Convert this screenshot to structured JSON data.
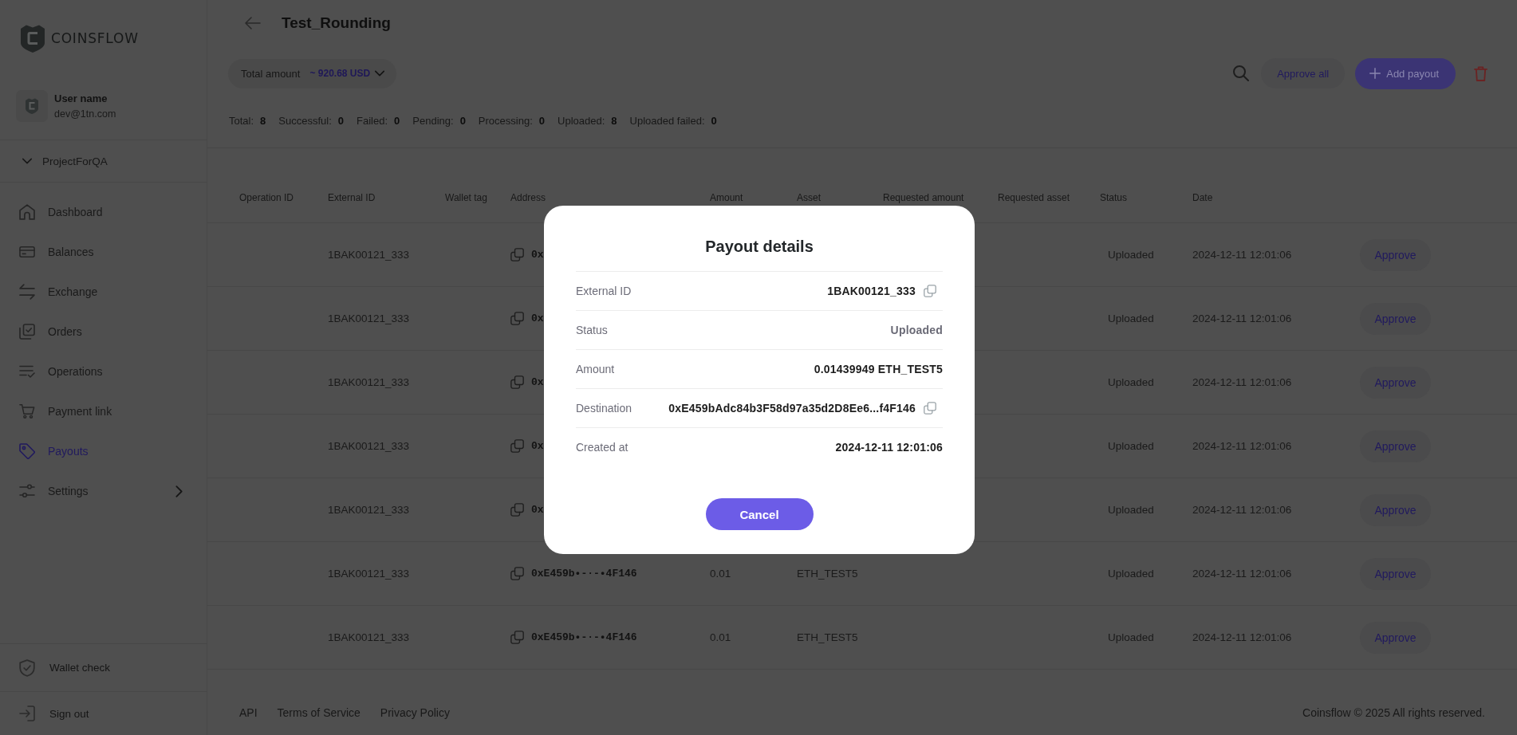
{
  "sidebar": {
    "brand": "COINSFLOW",
    "user": {
      "name": "User name",
      "email": "dev@1tn.com"
    },
    "project": "ProjectForQA",
    "nav": [
      {
        "label": "Dashboard",
        "selected": false,
        "kind": "link"
      },
      {
        "label": "Balances",
        "selected": false,
        "kind": "link"
      },
      {
        "label": "Exchange",
        "selected": false,
        "kind": "link"
      },
      {
        "label": "Orders",
        "selected": false,
        "kind": "link"
      },
      {
        "label": "Operations",
        "selected": false,
        "kind": "link"
      },
      {
        "label": "Payment link",
        "selected": false,
        "kind": "link"
      },
      {
        "label": "Payouts",
        "selected": true,
        "kind": "link"
      },
      {
        "label": "Settings",
        "selected": false,
        "kind": "group"
      }
    ],
    "bottom": [
      {
        "label": "Wallet check"
      },
      {
        "label": "Sign out"
      }
    ]
  },
  "header": {
    "title": "Test_Rounding",
    "total_amount": {
      "label": "Total amount",
      "value": "~ 920.68 USD"
    },
    "approve_all": "Approve all",
    "add_payout": "Add payout"
  },
  "stats": [
    {
      "label": "Total:",
      "value": "8"
    },
    {
      "label": "Successful:",
      "value": "0"
    },
    {
      "label": "Failed:",
      "value": "0"
    },
    {
      "label": "Pending:",
      "value": "0"
    },
    {
      "label": "Processing:",
      "value": "0"
    },
    {
      "label": "Uploaded:",
      "value": "8"
    },
    {
      "label": "Uploaded failed:",
      "value": "0"
    }
  ],
  "table": {
    "columns": [
      "Operation ID",
      "External ID",
      "Wallet tag",
      "Address",
      "Amount",
      "Asset",
      "Requested amount",
      "Requested asset",
      "Status",
      "Date"
    ],
    "rows": [
      {
        "external_id": "1BAK00121_333",
        "address": "0x",
        "status": "Uploaded",
        "date": "2024-12-11 12:01:06",
        "action": "Approve"
      },
      {
        "external_id": "1BAK00121_333",
        "address": "0x",
        "status": "Uploaded",
        "date": "2024-12-11 12:01:06",
        "action": "Approve"
      },
      {
        "external_id": "1BAK00121_333",
        "address": "0x",
        "status": "Uploaded",
        "date": "2024-12-11 12:01:06",
        "action": "Approve"
      },
      {
        "external_id": "1BAK00121_333",
        "address": "0x",
        "status": "Uploaded",
        "date": "2024-12-11 12:01:06",
        "action": "Approve"
      },
      {
        "external_id": "1BAK00121_333",
        "address": "0x",
        "status": "Uploaded",
        "date": "2024-12-11 12:01:06",
        "action": "Approve"
      },
      {
        "external_id": "1BAK00121_333",
        "address": "0xE459b•-·-•4F146",
        "amount": "0.01",
        "asset": "ETH_TEST5",
        "status": "Uploaded",
        "date": "2024-12-11 12:01:06",
        "action": "Approve"
      },
      {
        "external_id": "1BAK00121_333",
        "address": "0xE459b•-·-•4F146",
        "amount": "0.01",
        "asset": "ETH_TEST5",
        "status": "Uploaded",
        "date": "2024-12-11 12:01:06",
        "action": "Approve"
      }
    ]
  },
  "modal": {
    "title": "Payout details",
    "fields": [
      {
        "label": "External ID",
        "value": "1BAK00121_333",
        "kind": "copy"
      },
      {
        "label": "Status",
        "value": "Uploaded",
        "kind": "status"
      },
      {
        "label": "Amount",
        "value": "0.01439949 ETH_TEST5",
        "kind": "text"
      },
      {
        "label": "Destination",
        "value": "0xE459bAdc84b3F58d97a35d2D8Ee6...f4F146",
        "kind": "copy"
      },
      {
        "label": "Created at",
        "value": "2024-12-11 12:01:06",
        "kind": "text"
      }
    ],
    "cancel": "Cancel"
  },
  "footer": {
    "links": [
      "API",
      "Terms of Service",
      "Privacy Policy"
    ],
    "copyright": "Coinsflow © 2025 All rights reserved."
  }
}
